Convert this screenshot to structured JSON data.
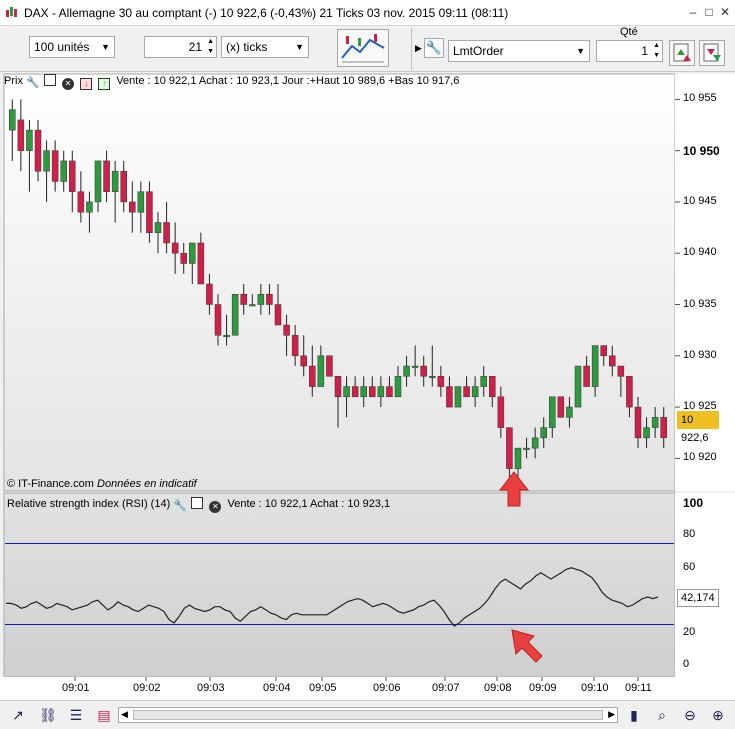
{
  "titlebar": {
    "title": "DAX - Allemagne 30 au comptant (-)  10 922,6 (-0,43%)   21 Ticks  03 nov. 2015 09:11 (08:11)",
    "minimize": "–",
    "maximize": "□",
    "close": "✕"
  },
  "toolbar": {
    "quantity_unit": "100 unités",
    "ticks_value": "21",
    "ticks_unit": "(x) ticks",
    "order_type": "LmtOrder",
    "qty_label": "Qté",
    "qty_value": "1"
  },
  "price_panel": {
    "label": "Prix",
    "info": "Vente : 10 922,1 Achat : 10 923,1 Jour :+Haut 10 989,6 +Bas 10 917,6",
    "copyright": "© IT-Finance.com",
    "disclaimer": "Données en indicatif",
    "current_price": "10 922,6"
  },
  "rsi_panel": {
    "label": "Relative strength index (RSI) (14)",
    "info": "Vente : 10 922,1 Achat : 10 923,1",
    "current_value": "42,174"
  },
  "y_axis_price": [
    "10 955",
    "10 950",
    "10 945",
    "10 940",
    "10 935",
    "10 930",
    "10 925",
    "10 920"
  ],
  "y_axis_rsi": [
    "100",
    "80",
    "60",
    "40",
    "20",
    "0"
  ],
  "x_axis": [
    "09:01",
    "09:02",
    "09:03",
    "09:04",
    "09:05",
    "09:06",
    "09:07",
    "09:08",
    "09:09",
    "09:10",
    "09:11"
  ],
  "colors": {
    "up": "#2e9a3e",
    "down": "#d0204a",
    "rsi_band": "#1a1aa8",
    "current_price_bg": "#f0c020",
    "arrow": "#e84040"
  },
  "chart_data": [
    {
      "type": "candlestick",
      "title": "Prix",
      "ylim": [
        10917.5,
        10956.5
      ],
      "candles": [
        [
          10952,
          10955,
          10949,
          10954
        ],
        [
          10953,
          10955,
          10948,
          10950
        ],
        [
          10950,
          10953,
          10946,
          10952
        ],
        [
          10952,
          10953,
          10947,
          10948
        ],
        [
          10948,
          10951,
          10945,
          10950
        ],
        [
          10950,
          10951,
          10946,
          10947
        ],
        [
          10947,
          10950,
          10946,
          10949
        ],
        [
          10949,
          10950,
          10944,
          10946
        ],
        [
          10946,
          10948,
          10943,
          10944
        ],
        [
          10944,
          10946,
          10942,
          10945
        ],
        [
          10945,
          10949,
          10944,
          10949
        ],
        [
          10949,
          10950,
          10945,
          10946
        ],
        [
          10946,
          10949,
          10943,
          10948
        ],
        [
          10948,
          10949,
          10944,
          10945
        ],
        [
          10945,
          10947,
          10942,
          10944
        ],
        [
          10944,
          10947,
          10942,
          10946
        ],
        [
          10946,
          10947,
          10941,
          10942
        ],
        [
          10942,
          10944,
          10940,
          10943
        ],
        [
          10943,
          10945,
          10940,
          10941
        ],
        [
          10941,
          10943,
          10938,
          10940
        ],
        [
          10940,
          10941,
          10938,
          10939
        ],
        [
          10939,
          10941,
          10937,
          10941
        ],
        [
          10941,
          10942,
          10937,
          10937
        ],
        [
          10937,
          10938,
          10934,
          10935
        ],
        [
          10935,
          10936,
          10931,
          10932
        ],
        [
          10932,
          10934,
          10931,
          10932
        ],
        [
          10932,
          10936,
          10932,
          10936
        ],
        [
          10936,
          10937,
          10934,
          10935
        ],
        [
          10935,
          10936,
          10935,
          10935
        ],
        [
          10935,
          10937,
          10934,
          10936
        ],
        [
          10936,
          10937,
          10934,
          10935
        ],
        [
          10935,
          10937,
          10933,
          10933
        ],
        [
          10933,
          10934,
          10930,
          10932
        ],
        [
          10932,
          10933,
          10929,
          10930
        ],
        [
          10930,
          10932,
          10928,
          10929
        ],
        [
          10929,
          10931,
          10926,
          10927
        ],
        [
          10927,
          10931,
          10927,
          10930
        ],
        [
          10930,
          10930,
          10928,
          10928
        ],
        [
          10928,
          10928,
          10923,
          10926
        ],
        [
          10926,
          10928,
          10924,
          10927
        ],
        [
          10927,
          10928,
          10926,
          10926
        ],
        [
          10926,
          10928,
          10925,
          10927
        ],
        [
          10927,
          10928,
          10926,
          10926
        ],
        [
          10926,
          10928,
          10925,
          10927
        ],
        [
          10927,
          10928,
          10926,
          10926
        ],
        [
          10926,
          10929,
          10926,
          10928
        ],
        [
          10928,
          10930,
          10927,
          10929
        ],
        [
          10929,
          10931,
          10928,
          10929
        ],
        [
          10929,
          10930,
          10927,
          10928
        ],
        [
          10928,
          10931,
          10927,
          10928
        ],
        [
          10928,
          10929,
          10926,
          10927
        ],
        [
          10927,
          10928,
          10925,
          10925
        ],
        [
          10925,
          10927,
          10925,
          10927
        ],
        [
          10927,
          10928,
          10926,
          10926
        ],
        [
          10926,
          10928,
          10925,
          10927
        ],
        [
          10927,
          10929,
          10926,
          10928
        ],
        [
          10928,
          10928,
          10925,
          10926
        ],
        [
          10926,
          10927,
          10922,
          10923
        ],
        [
          10923,
          10923,
          10918,
          10919
        ],
        [
          10919,
          10921,
          10918,
          10921
        ],
        [
          10921,
          10922,
          10920,
          10921
        ],
        [
          10921,
          10923,
          10920,
          10922
        ],
        [
          10922,
          10924,
          10921,
          10923
        ],
        [
          10923,
          10926,
          10922,
          10926
        ],
        [
          10926,
          10926,
          10924,
          10924
        ],
        [
          10924,
          10926,
          10923,
          10925
        ],
        [
          10925,
          10929,
          10925,
          10929
        ],
        [
          10929,
          10930,
          10927,
          10927
        ],
        [
          10927,
          10931,
          10926,
          10931
        ],
        [
          10931,
          10931,
          10929,
          10930
        ],
        [
          10930,
          10931,
          10928,
          10929
        ],
        [
          10929,
          10929,
          10926,
          10928
        ],
        [
          10928,
          10928,
          10924,
          10925
        ],
        [
          10925,
          10926,
          10921,
          10922
        ],
        [
          10922,
          10924,
          10921,
          10923
        ],
        [
          10923,
          10925,
          10922,
          10924
        ],
        [
          10924,
          10925,
          10921,
          10922
        ]
      ]
    },
    {
      "type": "line",
      "title": "Relative strength index (RSI) (14)",
      "ylim": [
        0,
        100
      ],
      "bands": [
        75,
        25
      ],
      "values": [
        38,
        38,
        37,
        35,
        36,
        38,
        39,
        37,
        35,
        36,
        38,
        37,
        36,
        34,
        35,
        36,
        37,
        39,
        40,
        37,
        34,
        36,
        39,
        37,
        36,
        34,
        33,
        35,
        37,
        36,
        35,
        33,
        28,
        26,
        30,
        35,
        37,
        35,
        34,
        33,
        34,
        36,
        36,
        34,
        33,
        29,
        27,
        30,
        33,
        34,
        36,
        34,
        32,
        31,
        29,
        28,
        31,
        32,
        31,
        31,
        31,
        31,
        31,
        31,
        33,
        35,
        37,
        39,
        40,
        41,
        40,
        38,
        36,
        37,
        38,
        37,
        35,
        33,
        32,
        33,
        34,
        36,
        37,
        39,
        40,
        37,
        33,
        28,
        24,
        26,
        29,
        31,
        33,
        35,
        38,
        42,
        47,
        51,
        53,
        51,
        49,
        47,
        50,
        52,
        55,
        57,
        55,
        53,
        55,
        57,
        59,
        60,
        59,
        58,
        56,
        54,
        50,
        45,
        42,
        40,
        39,
        38,
        36,
        37,
        39,
        41,
        42,
        41,
        42
      ]
    }
  ]
}
